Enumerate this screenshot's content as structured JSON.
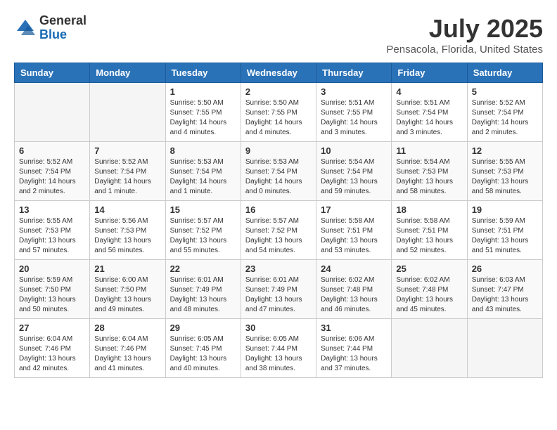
{
  "logo": {
    "general": "General",
    "blue": "Blue"
  },
  "title": "July 2025",
  "location": "Pensacola, Florida, United States",
  "weekdays": [
    "Sunday",
    "Monday",
    "Tuesday",
    "Wednesday",
    "Thursday",
    "Friday",
    "Saturday"
  ],
  "weeks": [
    [
      {
        "day": "",
        "info": ""
      },
      {
        "day": "",
        "info": ""
      },
      {
        "day": "1",
        "info": "Sunrise: 5:50 AM\nSunset: 7:55 PM\nDaylight: 14 hours and 4 minutes."
      },
      {
        "day": "2",
        "info": "Sunrise: 5:50 AM\nSunset: 7:55 PM\nDaylight: 14 hours and 4 minutes."
      },
      {
        "day": "3",
        "info": "Sunrise: 5:51 AM\nSunset: 7:55 PM\nDaylight: 14 hours and 3 minutes."
      },
      {
        "day": "4",
        "info": "Sunrise: 5:51 AM\nSunset: 7:54 PM\nDaylight: 14 hours and 3 minutes."
      },
      {
        "day": "5",
        "info": "Sunrise: 5:52 AM\nSunset: 7:54 PM\nDaylight: 14 hours and 2 minutes."
      }
    ],
    [
      {
        "day": "6",
        "info": "Sunrise: 5:52 AM\nSunset: 7:54 PM\nDaylight: 14 hours and 2 minutes."
      },
      {
        "day": "7",
        "info": "Sunrise: 5:52 AM\nSunset: 7:54 PM\nDaylight: 14 hours and 1 minute."
      },
      {
        "day": "8",
        "info": "Sunrise: 5:53 AM\nSunset: 7:54 PM\nDaylight: 14 hours and 1 minute."
      },
      {
        "day": "9",
        "info": "Sunrise: 5:53 AM\nSunset: 7:54 PM\nDaylight: 14 hours and 0 minutes."
      },
      {
        "day": "10",
        "info": "Sunrise: 5:54 AM\nSunset: 7:54 PM\nDaylight: 13 hours and 59 minutes."
      },
      {
        "day": "11",
        "info": "Sunrise: 5:54 AM\nSunset: 7:53 PM\nDaylight: 13 hours and 58 minutes."
      },
      {
        "day": "12",
        "info": "Sunrise: 5:55 AM\nSunset: 7:53 PM\nDaylight: 13 hours and 58 minutes."
      }
    ],
    [
      {
        "day": "13",
        "info": "Sunrise: 5:55 AM\nSunset: 7:53 PM\nDaylight: 13 hours and 57 minutes."
      },
      {
        "day": "14",
        "info": "Sunrise: 5:56 AM\nSunset: 7:53 PM\nDaylight: 13 hours and 56 minutes."
      },
      {
        "day": "15",
        "info": "Sunrise: 5:57 AM\nSunset: 7:52 PM\nDaylight: 13 hours and 55 minutes."
      },
      {
        "day": "16",
        "info": "Sunrise: 5:57 AM\nSunset: 7:52 PM\nDaylight: 13 hours and 54 minutes."
      },
      {
        "day": "17",
        "info": "Sunrise: 5:58 AM\nSunset: 7:51 PM\nDaylight: 13 hours and 53 minutes."
      },
      {
        "day": "18",
        "info": "Sunrise: 5:58 AM\nSunset: 7:51 PM\nDaylight: 13 hours and 52 minutes."
      },
      {
        "day": "19",
        "info": "Sunrise: 5:59 AM\nSunset: 7:51 PM\nDaylight: 13 hours and 51 minutes."
      }
    ],
    [
      {
        "day": "20",
        "info": "Sunrise: 5:59 AM\nSunset: 7:50 PM\nDaylight: 13 hours and 50 minutes."
      },
      {
        "day": "21",
        "info": "Sunrise: 6:00 AM\nSunset: 7:50 PM\nDaylight: 13 hours and 49 minutes."
      },
      {
        "day": "22",
        "info": "Sunrise: 6:01 AM\nSunset: 7:49 PM\nDaylight: 13 hours and 48 minutes."
      },
      {
        "day": "23",
        "info": "Sunrise: 6:01 AM\nSunset: 7:49 PM\nDaylight: 13 hours and 47 minutes."
      },
      {
        "day": "24",
        "info": "Sunrise: 6:02 AM\nSunset: 7:48 PM\nDaylight: 13 hours and 46 minutes."
      },
      {
        "day": "25",
        "info": "Sunrise: 6:02 AM\nSunset: 7:48 PM\nDaylight: 13 hours and 45 minutes."
      },
      {
        "day": "26",
        "info": "Sunrise: 6:03 AM\nSunset: 7:47 PM\nDaylight: 13 hours and 43 minutes."
      }
    ],
    [
      {
        "day": "27",
        "info": "Sunrise: 6:04 AM\nSunset: 7:46 PM\nDaylight: 13 hours and 42 minutes."
      },
      {
        "day": "28",
        "info": "Sunrise: 6:04 AM\nSunset: 7:46 PM\nDaylight: 13 hours and 41 minutes."
      },
      {
        "day": "29",
        "info": "Sunrise: 6:05 AM\nSunset: 7:45 PM\nDaylight: 13 hours and 40 minutes."
      },
      {
        "day": "30",
        "info": "Sunrise: 6:05 AM\nSunset: 7:44 PM\nDaylight: 13 hours and 38 minutes."
      },
      {
        "day": "31",
        "info": "Sunrise: 6:06 AM\nSunset: 7:44 PM\nDaylight: 13 hours and 37 minutes."
      },
      {
        "day": "",
        "info": ""
      },
      {
        "day": "",
        "info": ""
      }
    ]
  ]
}
